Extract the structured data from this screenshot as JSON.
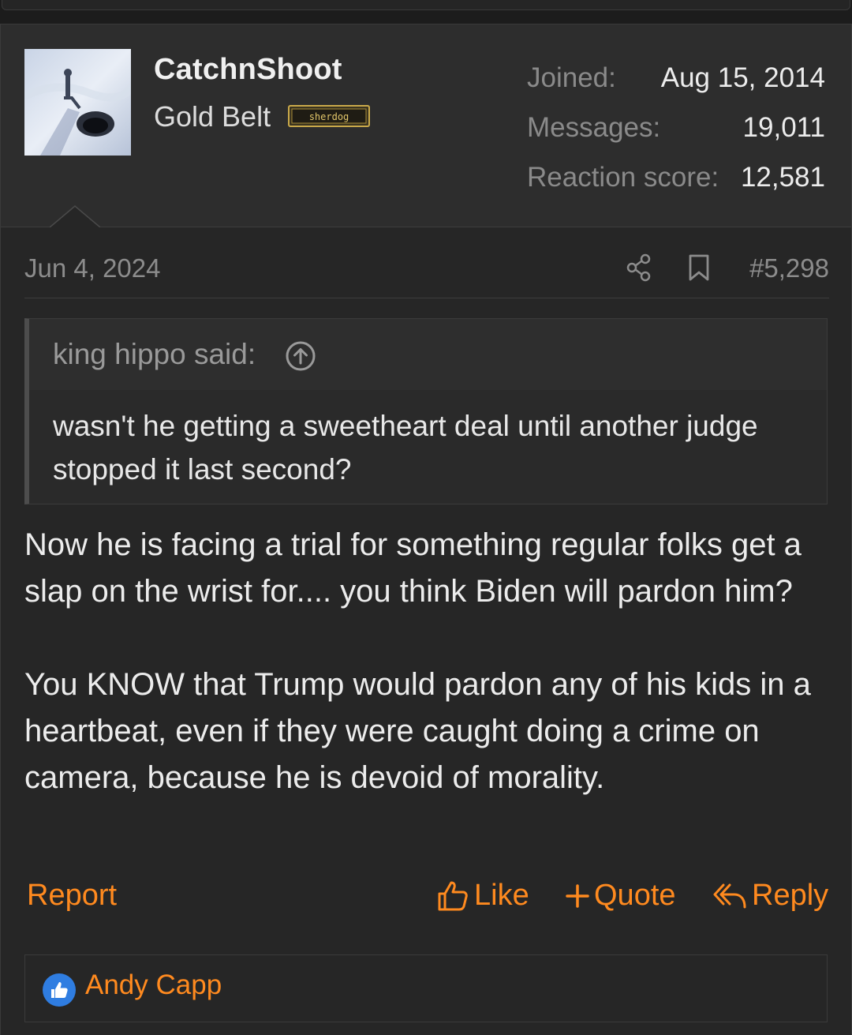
{
  "user": {
    "name": "CatchnShoot",
    "title": "Gold Belt",
    "badge_text": "sherdog",
    "stats": [
      {
        "label": "Joined:",
        "value": "Aug 15, 2014"
      },
      {
        "label": "Messages:",
        "value": "19,011"
      },
      {
        "label": "Reaction score:",
        "value": "12,581"
      }
    ]
  },
  "post": {
    "date": "Jun 4, 2024",
    "number": "#5,298",
    "quote": {
      "author": "king hippo said:",
      "text": "wasn't he getting a sweetheart deal until another judge stopped it last second?"
    },
    "paragraphs": [
      "Now he is facing a trial for something regular folks get a slap on the wrist for.... you think Biden will pardon him?",
      "You KNOW that Trump would pardon any of his kids in a heartbeat, even if they were caught doing a crime on camera, because he is devoid of morality."
    ]
  },
  "actions": {
    "report": "Report",
    "like": "Like",
    "quote": "Quote",
    "reply": "Reply"
  },
  "reactions": {
    "user": "Andy Capp"
  },
  "colors": {
    "accent": "#ff8a1f",
    "background": "#262626",
    "like_badge": "#2f7de1"
  }
}
